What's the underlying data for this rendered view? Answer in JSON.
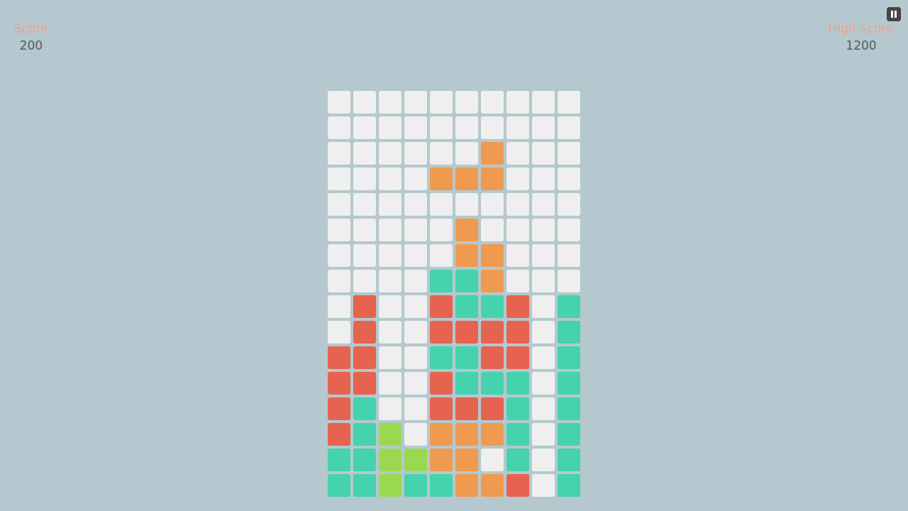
{
  "score": {
    "label": "Score",
    "value": "200"
  },
  "high_score": {
    "label": "High Score",
    "value": "1200"
  },
  "pause_button": {
    "paused": false
  },
  "board": {
    "rows": [
      [
        null,
        null,
        null,
        null,
        null,
        null,
        null,
        null,
        null,
        null
      ],
      [
        null,
        null,
        null,
        null,
        null,
        null,
        null,
        null,
        null,
        null
      ],
      [
        null,
        null,
        null,
        null,
        null,
        null,
        "#ef9a4e",
        null,
        null,
        null
      ],
      [
        null,
        null,
        null,
        null,
        "#ef9a4e",
        "#ef9a4e",
        "#ef9a4e",
        null,
        null,
        null
      ],
      [
        null,
        null,
        null,
        null,
        null,
        null,
        null,
        null,
        null,
        null
      ],
      [
        null,
        null,
        null,
        null,
        null,
        "#ef9a4e",
        null,
        null,
        null,
        null
      ],
      [
        null,
        null,
        null,
        null,
        null,
        "#ef9a4e",
        "#ef9a4e",
        null,
        null,
        null
      ],
      [
        null,
        null,
        null,
        null,
        "#44d3ad",
        "#44d3ad",
        "#ef9a4e",
        null,
        null,
        null
      ],
      [
        null,
        "#e5634f",
        null,
        null,
        "#e5634f",
        "#44d3ad",
        "#44d3ad",
        "#e5634f",
        null,
        "#44d3ad"
      ],
      [
        null,
        "#e5634f",
        null,
        null,
        "#e5634f",
        "#e5634f",
        "#e5634f",
        "#e5634f",
        null,
        "#44d3ad"
      ],
      [
        "#e5634f",
        "#e5634f",
        null,
        null,
        "#44d3ad",
        "#44d3ad",
        "#e5634f",
        "#e5634f",
        null,
        "#44d3ad"
      ],
      [
        "#e5634f",
        "#e5634f",
        null,
        null,
        "#e5634f",
        "#44d3ad",
        "#44d3ad",
        "#44d3ad",
        null,
        "#44d3ad"
      ],
      [
        "#e5634f",
        "#44d3ad",
        null,
        null,
        "#e5634f",
        "#e5634f",
        "#e5634f",
        "#44d3ad",
        null,
        "#44d3ad"
      ],
      [
        "#e5634f",
        "#44d3ad",
        "#9ad94f",
        null,
        "#ef9a4e",
        "#ef9a4e",
        "#ef9a4e",
        "#44d3ad",
        null,
        "#44d3ad"
      ],
      [
        "#44d3ad",
        "#44d3ad",
        "#9ad94f",
        "#9ad94f",
        "#ef9a4e",
        "#ef9a4e",
        null,
        "#44d3ad",
        null,
        "#44d3ad"
      ],
      [
        "#44d3ad",
        "#44d3ad",
        "#9ad94f",
        "#44d3ad",
        "#44d3ad",
        "#ef9a4e",
        "#ef9a4e",
        "#e5634f",
        null,
        "#44d3ad"
      ]
    ]
  }
}
